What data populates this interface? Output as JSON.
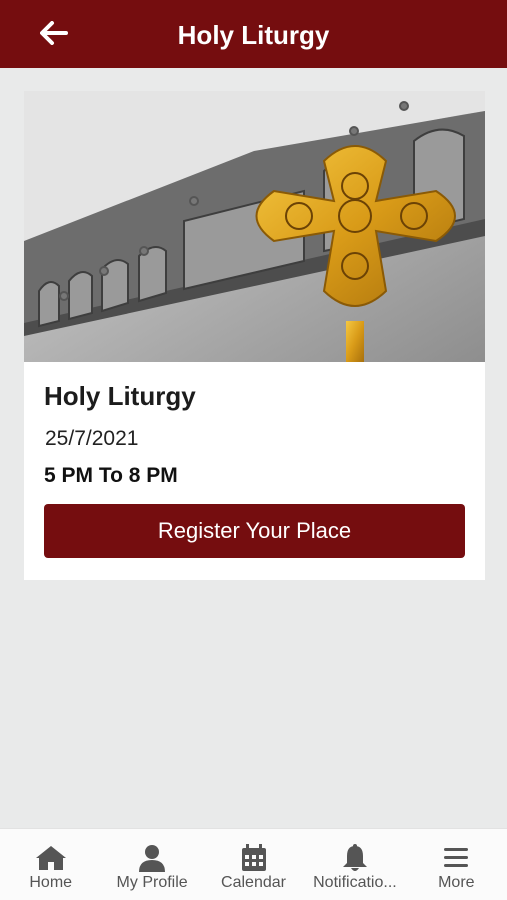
{
  "header": {
    "title": "Holy Liturgy",
    "back_icon": "arrow-left-icon",
    "background_color": "#750d0f"
  },
  "event": {
    "image_icon": "coptic-cross-church-photo",
    "title": "Holy Liturgy",
    "date": "25/7/2021",
    "time": "5 PM To 8 PM",
    "register_label": "Register Your Place"
  },
  "tabbar": {
    "items": [
      {
        "label": "Home",
        "icon": "home-icon"
      },
      {
        "label": "My Profile",
        "icon": "user-icon"
      },
      {
        "label": "Calendar",
        "icon": "calendar-icon"
      },
      {
        "label": "Notificatio...",
        "icon": "bell-icon"
      },
      {
        "label": "More",
        "icon": "menu-icon"
      }
    ]
  }
}
